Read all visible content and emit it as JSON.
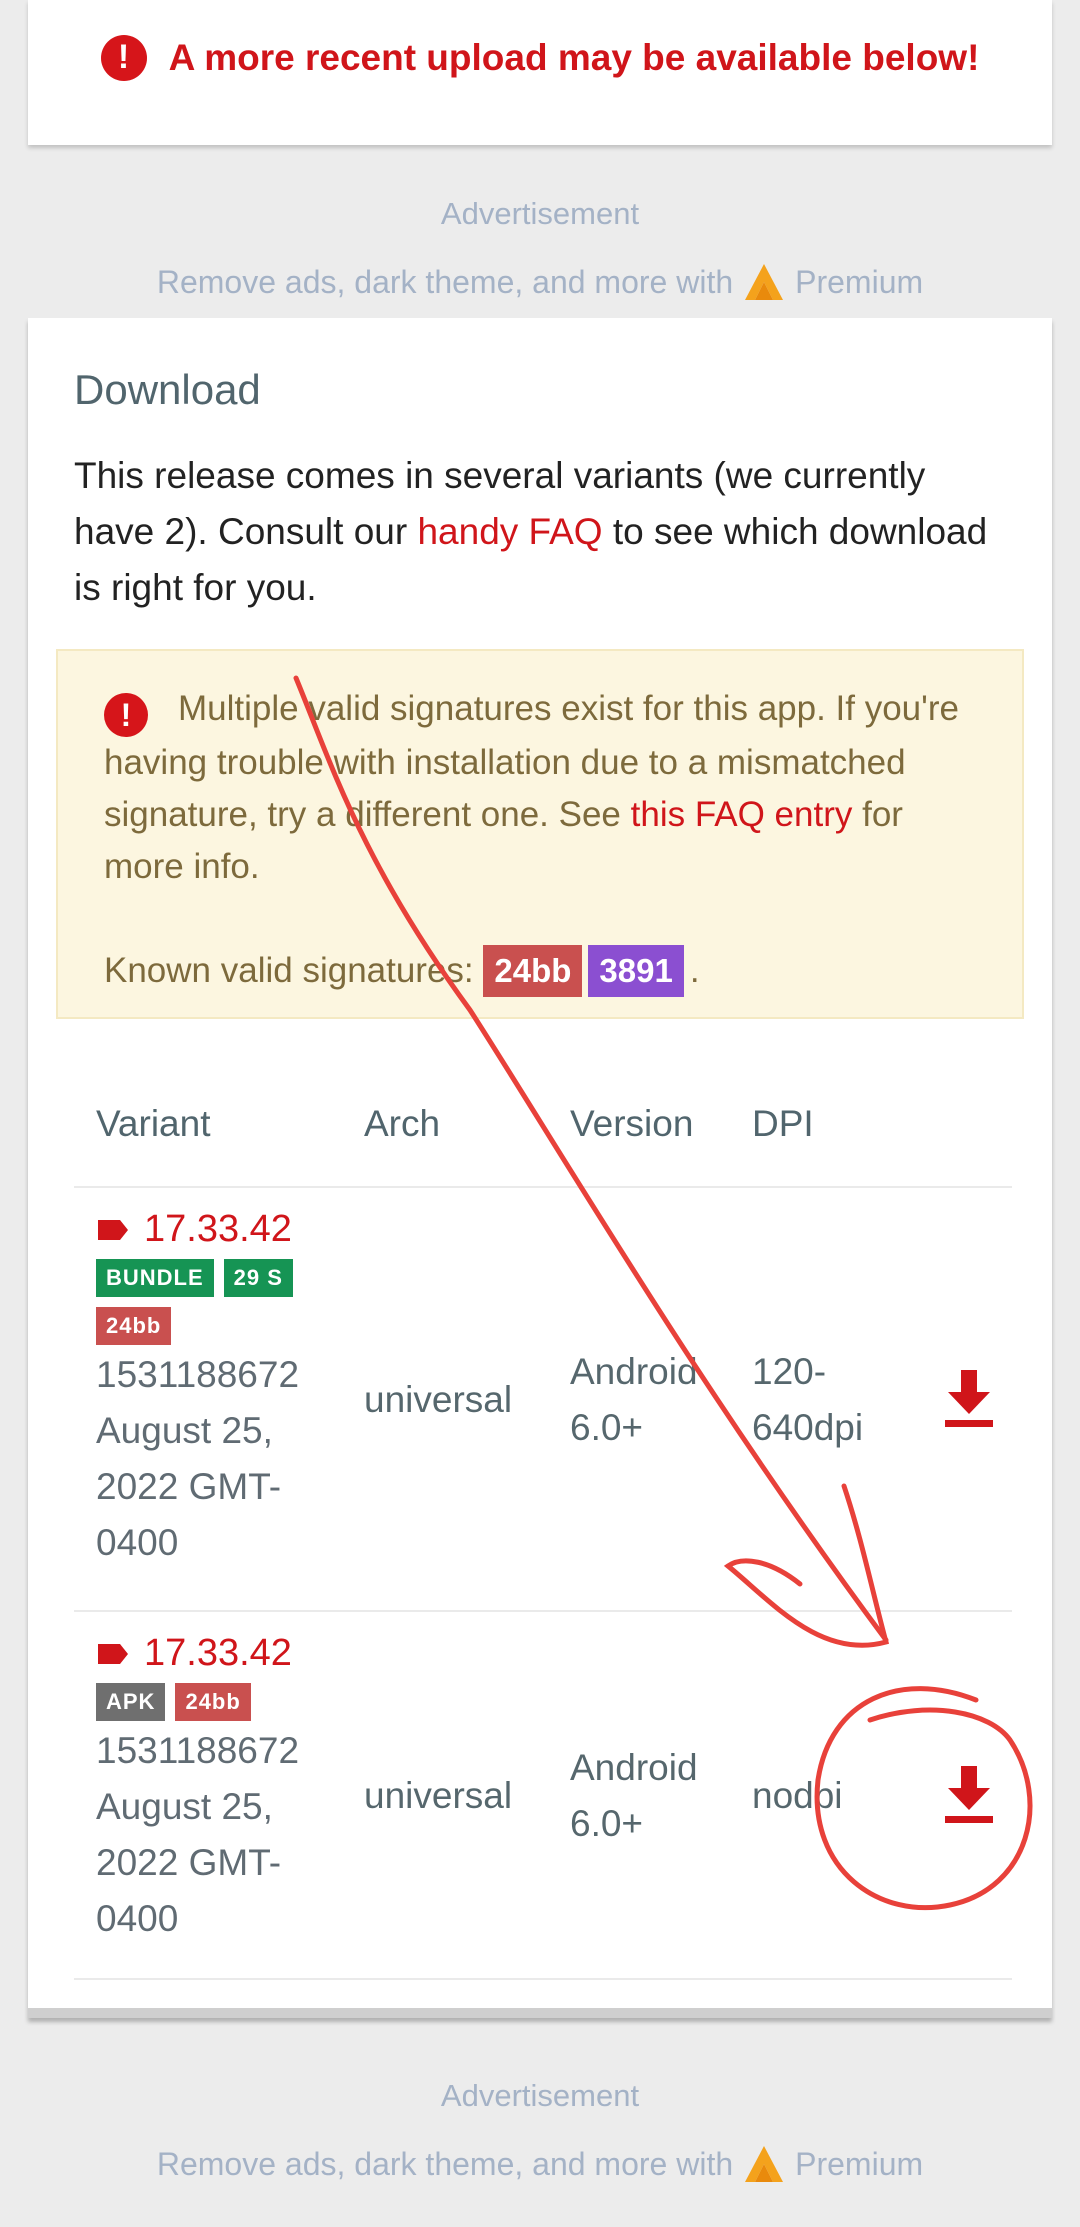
{
  "notice": {
    "text": "A more recent upload may be available below!"
  },
  "ads": [
    {
      "label": "Advertisement",
      "text": "Remove ads, dark theme, and more with",
      "premium": "Premium"
    },
    {
      "label": "Advertisement",
      "text": "Remove ads, dark theme, and more with",
      "premium": "Premium"
    }
  ],
  "download": {
    "title": "Download",
    "desc_before": "This release comes in several variants (we currently have 2). Consult our ",
    "desc_link": "handy FAQ",
    "desc_after": " to see which download is right for you.",
    "warning": {
      "text_before": "Multiple valid signatures exist for this app. If you're having trouble with installation due to a mismatched signature, try a different one. See ",
      "link": "this FAQ entry",
      "text_after": " for more info.",
      "sig_label": "Known valid signatures: ",
      "signatures": [
        "24bb",
        "3891"
      ],
      "sig_end": "."
    },
    "table": {
      "headers": {
        "variant": "Variant",
        "arch": "Arch",
        "version": "Version",
        "dpi": "DPI"
      },
      "rows": [
        {
          "version": "17.33.42",
          "badges": [
            "BUNDLE",
            "29 S",
            "24bb"
          ],
          "code": "1531188672",
          "date": "August 25, 2022 GMT-0400",
          "arch": "universal",
          "min_android": "Android 6.0+",
          "dpi": "120-640dpi"
        },
        {
          "version": "17.33.42",
          "badges": [
            "APK",
            "24bb"
          ],
          "code": "1531188672",
          "date": "August 25, 2022 GMT-0400",
          "arch": "universal",
          "min_android": "Android 6.0+",
          "dpi": "nodpi"
        }
      ]
    }
  },
  "colors": {
    "accent_red": "#d0151a",
    "badge_green": "#169454",
    "badge_sig_red": "#c9504f",
    "badge_sig_purple": "#8b4fd1",
    "badge_gray": "#6f6f6f",
    "annotation": "#e8413a"
  }
}
